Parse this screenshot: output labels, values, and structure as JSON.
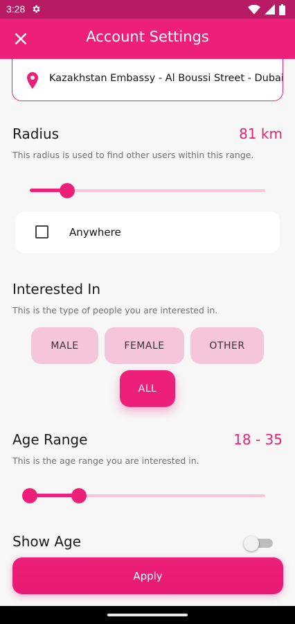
{
  "status_bar": {
    "time": "3:28"
  },
  "app_bar": {
    "title": "Account Settings"
  },
  "location": {
    "text": "Kazakhstan Embassy - Al Boussi Street - Dubai"
  },
  "radius": {
    "title": "Radius",
    "value": "81 km",
    "description": "This radius is used to find other users within this range.",
    "slider_fraction": 0.16
  },
  "anywhere": {
    "label": "Anywhere",
    "checked": false
  },
  "interested_in": {
    "title": "Interested In",
    "description": "This is the type of people you are interested in.",
    "options": [
      "MALE",
      "FEMALE",
      "OTHER",
      "ALL"
    ],
    "selected": "ALL"
  },
  "age_range": {
    "title": "Age Range",
    "value": "18 - 35",
    "description": "This is the age range you are interested in.",
    "min_fraction": 0.0,
    "max_fraction": 0.21
  },
  "show_age": {
    "title": "Show Age",
    "enabled": false
  },
  "apply": {
    "label": "Apply"
  },
  "colors": {
    "accent": "#ec2078",
    "accent_light": "#f5c6da",
    "status_bar": "#b81a63"
  }
}
